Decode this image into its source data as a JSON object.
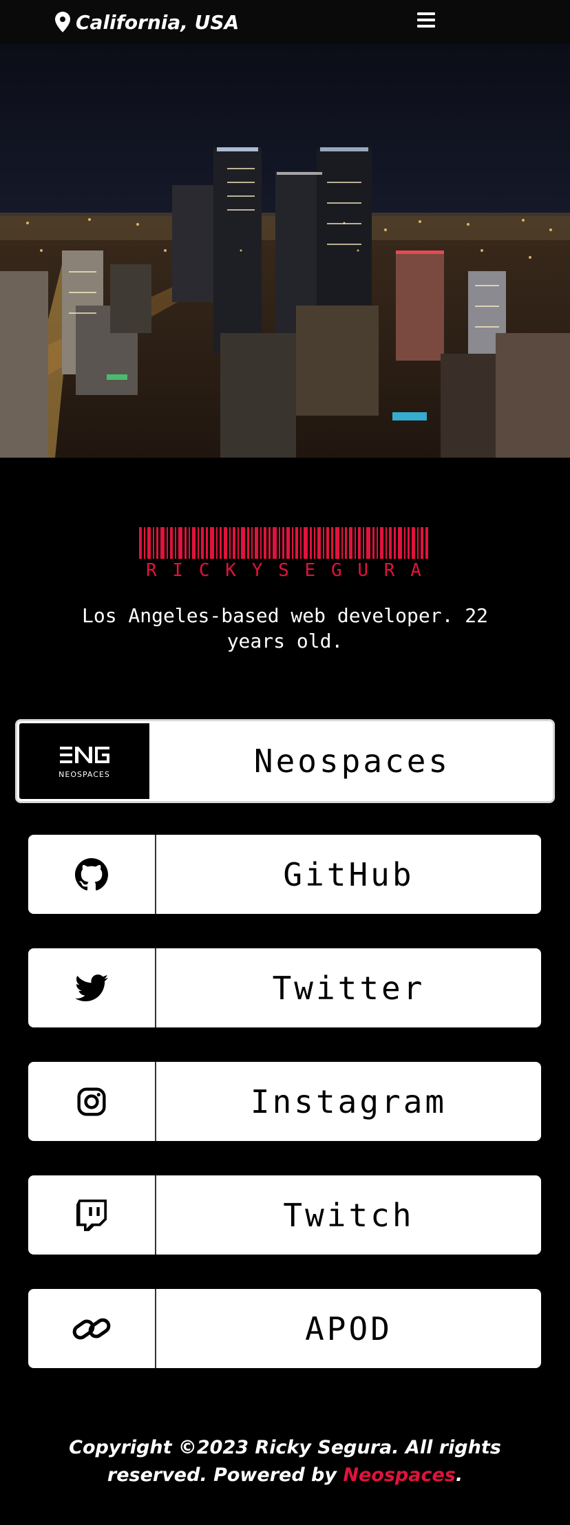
{
  "header": {
    "location": "California, USA",
    "location_icon": "map-pin-icon",
    "menu_icon": "hamburger-menu-icon"
  },
  "profile": {
    "name_barcode": "RICKYSEGURA",
    "name_letters": [
      "R",
      "I",
      "C",
      "K",
      "Y",
      "S",
      "E",
      "G",
      "U",
      "R",
      "A"
    ],
    "tagline": "Los Angeles-based web developer. 22 years old.",
    "accent_color": "#e0133c"
  },
  "links": [
    {
      "label": "Neospaces",
      "icon": "neospaces-logo",
      "logo_text": "NEOSPACES"
    },
    {
      "label": "GitHub",
      "icon": "github-icon"
    },
    {
      "label": "Twitter",
      "icon": "twitter-icon"
    },
    {
      "label": "Instagram",
      "icon": "instagram-icon"
    },
    {
      "label": "Twitch",
      "icon": "twitch-icon"
    },
    {
      "label": "APOD",
      "icon": "link-icon"
    }
  ],
  "footer": {
    "text_before": "Copyright ©2023 Ricky Segura. All rights reserved. Powered by ",
    "brand": "Neospaces",
    "text_after": "."
  }
}
